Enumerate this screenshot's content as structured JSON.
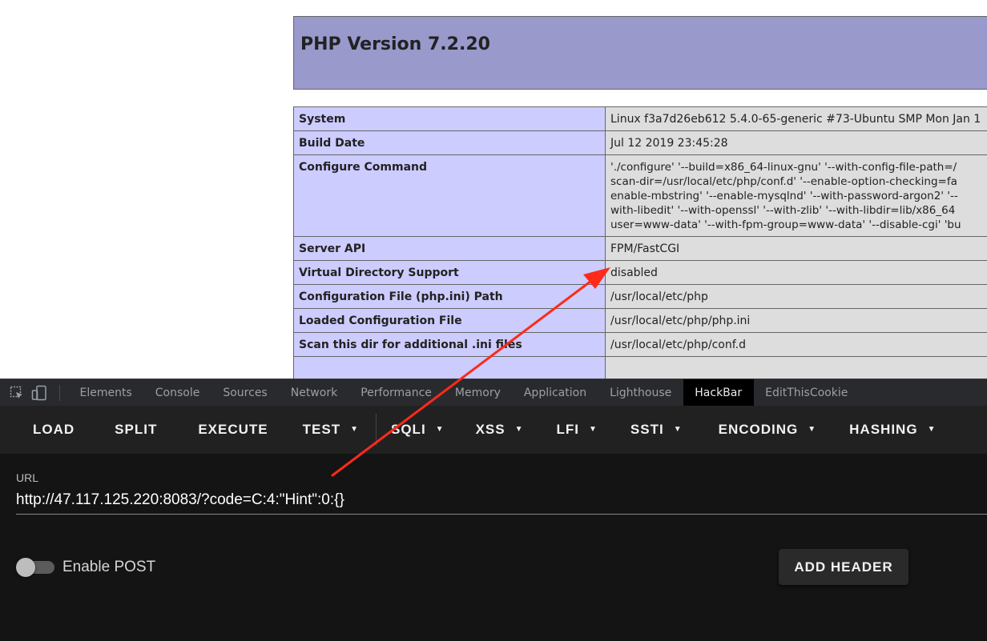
{
  "php_info": {
    "title": "PHP Version 7.2.20",
    "rows": [
      {
        "key": "System",
        "value": "Linux f3a7d26eb612 5.4.0-65-generic #73-Ubuntu SMP Mon Jan 1"
      },
      {
        "key": "Build Date",
        "value": "Jul 12 2019 23:45:28"
      },
      {
        "key": "Configure Command",
        "lines": [
          "'./configure' '--build=x86_64-linux-gnu' '--with-config-file-path=/",
          "scan-dir=/usr/local/etc/php/conf.d' '--enable-option-checking=fa",
          "enable-mbstring' '--enable-mysqlnd' '--with-password-argon2' '--",
          "with-libedit' '--with-openssl' '--with-zlib' '--with-libdir=lib/x86_64",
          "user=www-data' '--with-fpm-group=www-data' '--disable-cgi' 'bu"
        ]
      },
      {
        "key": "Server API",
        "value": "FPM/FastCGI"
      },
      {
        "key": "Virtual Directory Support",
        "value": "disabled"
      },
      {
        "key": "Configuration File (php.ini) Path",
        "value": "/usr/local/etc/php"
      },
      {
        "key": "Loaded Configuration File",
        "value": "/usr/local/etc/php/php.ini"
      },
      {
        "key": "Scan this dir for additional .ini files",
        "value": "/usr/local/etc/php/conf.d"
      }
    ]
  },
  "devtools": {
    "tabs": [
      "Elements",
      "Console",
      "Sources",
      "Network",
      "Performance",
      "Memory",
      "Application",
      "Lighthouse",
      "HackBar",
      "EditThisCookie"
    ],
    "active_tab": "HackBar"
  },
  "hackbar": {
    "buttons": {
      "load": "LOAD",
      "split": "SPLIT",
      "execute": "EXECUTE",
      "test": "TEST",
      "sqli": "SQLI",
      "xss": "XSS",
      "lfi": "LFI",
      "ssti": "SSTI",
      "encoding": "ENCODING",
      "hashing": "HASHING"
    },
    "url_label": "URL",
    "url_value": "http://47.117.125.220:8083/?code=C:4:\"Hint\":0:{}",
    "enable_post_label": "Enable POST",
    "add_header_label": "ADD HEADER"
  },
  "colors": {
    "php_header": "#9999cc",
    "php_key_cell": "#ccccff",
    "php_value_cell": "#dddddd",
    "annotation_arrow": "#ff2a1a"
  }
}
